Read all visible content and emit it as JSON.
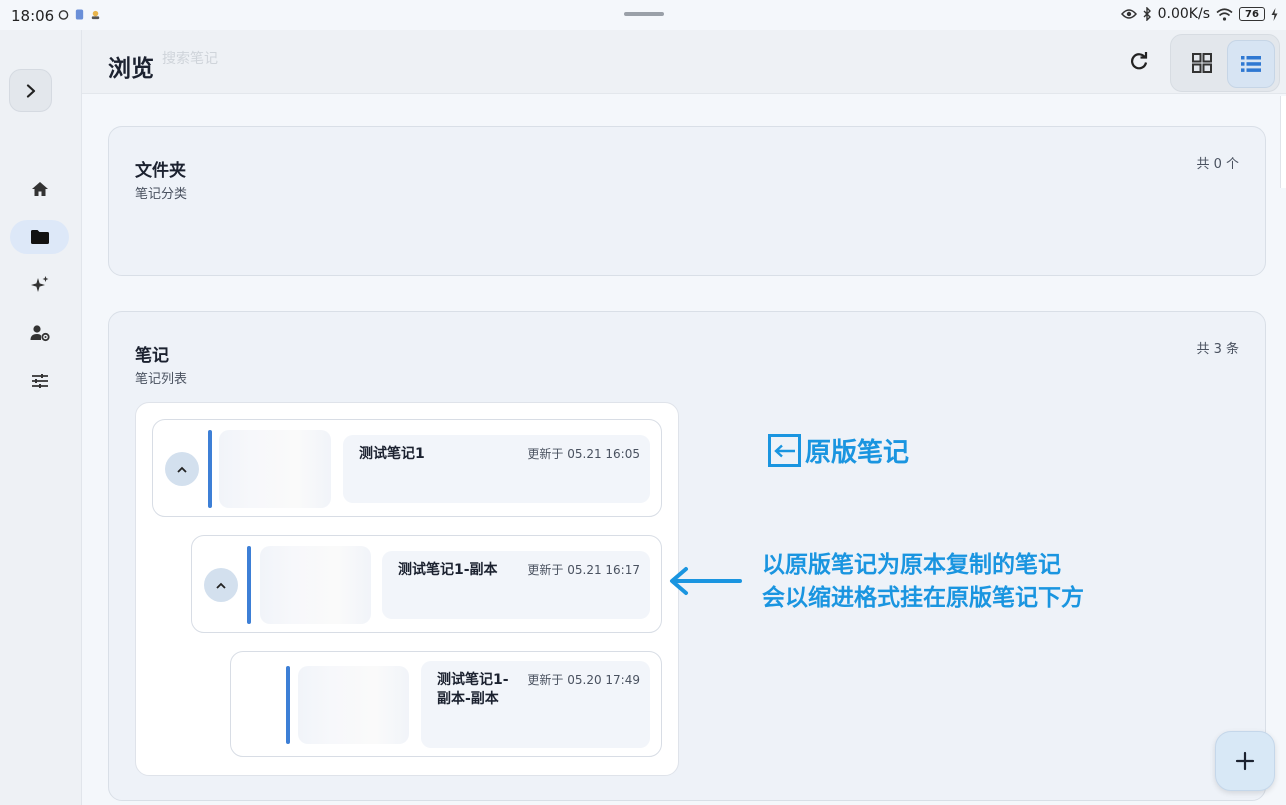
{
  "status_bar": {
    "time": "18:06",
    "network_speed": "0.00K/s",
    "battery": "76",
    "icons": [
      "alarm-icon",
      "app-badge-icon",
      "notification-icon",
      "eye-icon",
      "bluetooth-icon",
      "wifi-icon",
      "battery-icon",
      "charging-icon"
    ]
  },
  "rail": {
    "toggle_icon": "chevron-right-icon",
    "items": [
      {
        "icon": "home-icon",
        "active": false
      },
      {
        "icon": "folder-icon",
        "active": true
      },
      {
        "icon": "sparkle-icon",
        "active": false
      },
      {
        "icon": "user-settings-icon",
        "active": false
      },
      {
        "icon": "sliders-icon",
        "active": false
      }
    ]
  },
  "header": {
    "title": "浏览",
    "search_placeholder": "搜索笔记",
    "refresh_icon": "refresh-icon",
    "view_modes": [
      {
        "icon": "grid-view-icon",
        "selected": false
      },
      {
        "icon": "list-view-icon",
        "selected": true
      }
    ]
  },
  "folders": {
    "title": "文件夹",
    "subtitle": "笔记分类",
    "count": "共 0 个"
  },
  "notes": {
    "title": "笔记",
    "subtitle": "笔记列表",
    "count": "共 3 条",
    "items": [
      {
        "title": "测试笔记1",
        "updated": "更新于 05.21 16:05",
        "indent_level": 0,
        "has_children": true
      },
      {
        "title": "测试笔记1-副本",
        "updated": "更新于 05.21 16:17",
        "indent_level": 1,
        "has_children": true
      },
      {
        "title_line1": "测试笔记1-",
        "title_line2": "副本-副本",
        "updated": "更新于 05.20 17:49",
        "indent_level": 2,
        "has_children": false
      }
    ]
  },
  "annotations": {
    "original_label": "原版笔记",
    "desc_line1": "以原版笔记为原本复制的笔记",
    "desc_line2": "会以缩进格式挂在原版笔记下方",
    "color": "#1a95e0"
  },
  "fab": {
    "icon": "plus-icon"
  },
  "colors": {
    "accent": "#3d7fd6",
    "rail_active": "#dde8f8",
    "card_bg": "#eef2f8"
  }
}
